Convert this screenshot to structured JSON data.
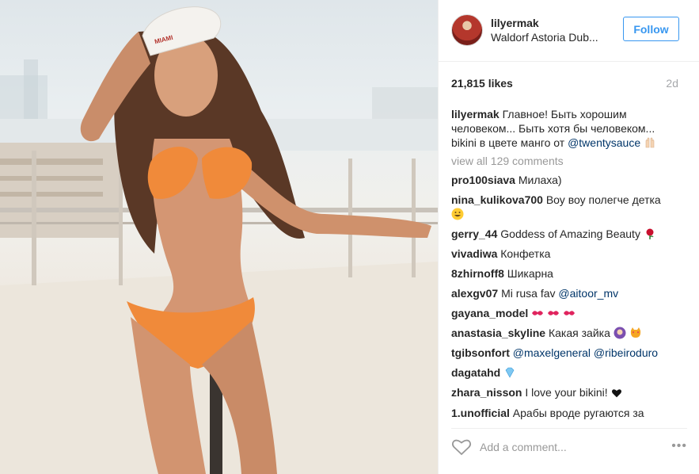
{
  "header": {
    "username": "lilyermak",
    "location": "Waldorf Astoria Dub...",
    "follow_label": "Follow"
  },
  "stats": {
    "likes": "21,815 likes",
    "age": "2d"
  },
  "caption": {
    "username": "lilyermak",
    "text": "Главное! Быть хорошим человеком... Быть хотя бы человеком... bikini в цвете манго от",
    "mention": "@twentysauce"
  },
  "view_all": "view all 129 comments",
  "comments": [
    {
      "user": "pro100siava",
      "text": "Милаха)"
    },
    {
      "user": "nina_kulikova700",
      "text": "Воу воу полегче детка"
    },
    {
      "user": "gerry_44",
      "text": "Goddess of Amazing Beauty"
    },
    {
      "user": "vivadiwa",
      "text": "Конфетка"
    },
    {
      "user": "8zhirnoff8",
      "text": "Шикарна"
    },
    {
      "user": "alexgv07",
      "text": "Mi rusa fav",
      "mention": "@aitoor_mv"
    },
    {
      "user": "gayana_model",
      "text": ""
    },
    {
      "user": "anastasia_skyline",
      "text": "Какая зайка"
    },
    {
      "user": "tgibsonfort",
      "text": "",
      "mention": "@maxelgeneral @ribeiroduro"
    },
    {
      "user": "dagatahd",
      "text": ""
    },
    {
      "user": "zhara_nisson",
      "text": "I love your bikini!"
    },
    {
      "user": "1.unofficial",
      "text": "Арабы вроде ругаются за"
    }
  ],
  "footer": {
    "add_comment_placeholder": "Add a comment...",
    "more_label": "•••"
  },
  "photo": {
    "cap_text": "MIAMI"
  },
  "colors": {
    "accent": "#3897f0",
    "bikini": "#f08a3a",
    "mention": "#003569"
  }
}
